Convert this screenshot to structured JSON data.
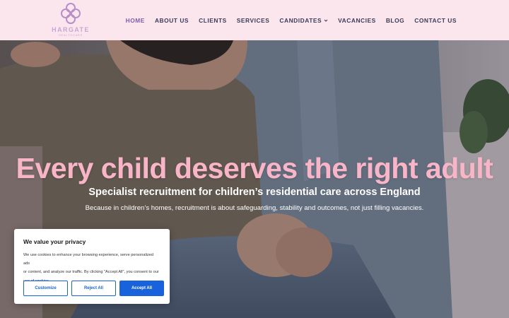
{
  "brand": {
    "name": "HARGATE",
    "tagline": "HEALTHCARE",
    "color": "#c9a6d3"
  },
  "nav": {
    "items": [
      {
        "label": "HOME",
        "active": true
      },
      {
        "label": "ABOUT US"
      },
      {
        "label": "CLIENTS"
      },
      {
        "label": "SERVICES"
      },
      {
        "label": "CANDIDATES",
        "icon": "chevron-down-icon"
      },
      {
        "label": "VACANCIES"
      },
      {
        "label": "BLOG"
      },
      {
        "label": "CONTACT US"
      }
    ],
    "active_color": "#7b5fa8"
  },
  "hero": {
    "title": "Every child deserves the right adult",
    "subtitle": "Specialist recruitment for children’s residential care across England",
    "description": "Because in children’s homes, recruitment is about safeguarding, stability and outcomes, not just filling vacancies.",
    "title_color": "#f7b5c7"
  },
  "cookie": {
    "title": "We value your privacy",
    "text_lines": [
      "We use cookies to enhance your browsing experience, serve personalized ads",
      "or content, and analyze our traffic. By clicking \"Accept All\", you consent to our",
      "use of cookies."
    ],
    "buttons": {
      "customize": "Customize",
      "reject": "Reject All",
      "accept": "Accept All"
    },
    "accent": "#1863dc"
  }
}
